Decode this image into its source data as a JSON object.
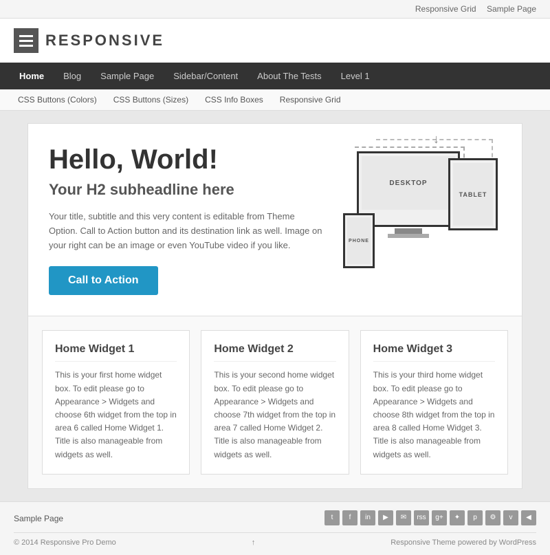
{
  "topbar": {
    "links": [
      {
        "label": "Responsive Grid",
        "href": "#"
      },
      {
        "label": "Sample Page",
        "href": "#"
      }
    ]
  },
  "header": {
    "site_title": "RESPONSIVE",
    "logo_alt": "Responsive logo"
  },
  "primary_nav": {
    "items": [
      {
        "label": "Home",
        "active": true
      },
      {
        "label": "Blog"
      },
      {
        "label": "Sample Page"
      },
      {
        "label": "Sidebar/Content"
      },
      {
        "label": "About The Tests"
      },
      {
        "label": "Level 1"
      }
    ]
  },
  "secondary_nav": {
    "items": [
      {
        "label": "CSS Buttons (Colors)"
      },
      {
        "label": "CSS Buttons (Sizes)"
      },
      {
        "label": "CSS Info Boxes"
      },
      {
        "label": "Responsive Grid"
      }
    ]
  },
  "hero": {
    "headline": "Hello, World!",
    "subheadline": "Your H2 subheadline here",
    "body": "Your title, subtitle and this very content is editable from Theme Option. Call to Action button and its destination link as well. Image on your right can be an image or even YouTube video if you like.",
    "cta_label": "Call to Action",
    "device_desktop_label": "DESKTOP",
    "device_tablet_label": "TABLET",
    "device_phone_label": "PHONE"
  },
  "widgets": [
    {
      "title": "Home Widget 1",
      "body": "This is your first home widget box. To edit please go to Appearance > Widgets and choose 6th widget from the top in area 6 called Home Widget 1. Title is also manageable from widgets as well."
    },
    {
      "title": "Home Widget 2",
      "body": "This is your second home widget box. To edit please go to Appearance > Widgets and choose 7th widget from the top in area 7 called Home Widget 2. Title is also manageable from widgets as well."
    },
    {
      "title": "Home Widget 3",
      "body": "This is your third home widget box. To edit please go to Appearance > Widgets and choose 8th widget from the top in area 8 called Home Widget 3. Title is also manageable from widgets as well."
    }
  ],
  "footer": {
    "nav_links": [
      {
        "label": "Sample Page"
      }
    ],
    "social_icons": [
      {
        "label": "t",
        "name": "twitter-icon"
      },
      {
        "label": "f",
        "name": "facebook-icon"
      },
      {
        "label": "in",
        "name": "linkedin-icon"
      },
      {
        "label": "▶",
        "name": "youtube-icon"
      },
      {
        "label": "✉",
        "name": "email-icon"
      },
      {
        "label": "rss",
        "name": "rss-icon"
      },
      {
        "label": "g+",
        "name": "googleplus-icon"
      },
      {
        "label": "✦",
        "name": "star-icon"
      },
      {
        "label": "p",
        "name": "pinterest-icon"
      },
      {
        "label": "⚙",
        "name": "settings-icon"
      },
      {
        "label": "v",
        "name": "vimeo-icon"
      },
      {
        "label": "◀",
        "name": "extra-icon"
      }
    ],
    "copyright": "© 2014 Responsive Pro Demo",
    "powered_by": "Responsive Theme",
    "powered_by_suffix": " powered by ",
    "wordpress": "WordPress",
    "arrow_up": "↑"
  }
}
